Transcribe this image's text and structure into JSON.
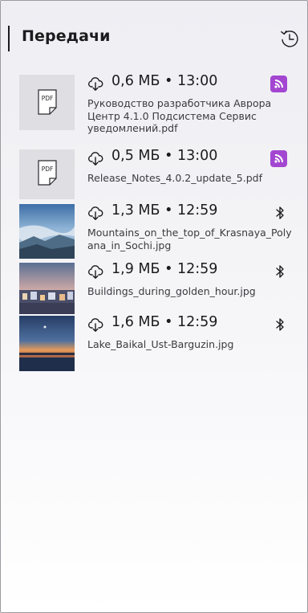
{
  "header": {
    "title": "Передачи",
    "history_icon": "history-icon"
  },
  "transfers": [
    {
      "thumb": "pdf",
      "pdf_label": "PDF",
      "size": "0,6 МБ",
      "time": "13:00",
      "channel": "aurora-badge-icon",
      "name": "Руководство разработчика Аврора Центр 4.1.0 Подсистема Сервис уведомлений.pdf"
    },
    {
      "thumb": "pdf",
      "pdf_label": "PDF",
      "size": "0,5 МБ",
      "time": "13:00",
      "channel": "aurora-badge-icon",
      "name": "Release_Notes_4.0.2_update_5.pdf"
    },
    {
      "thumb": "photo-mountains",
      "size": "1,3 МБ",
      "time": "12:59",
      "channel": "bluetooth-icon",
      "name": "Mountains_on_the_top_of_Krasnaya_Polyana_in_Sochi.jpg"
    },
    {
      "thumb": "photo-buildings",
      "size": "1,9 МБ",
      "time": "12:59",
      "channel": "bluetooth-icon",
      "name": "Buildings_during_golden_hour.jpg"
    },
    {
      "thumb": "photo-lake",
      "size": "1,6 МБ",
      "time": "12:59",
      "channel": "bluetooth-icon",
      "name": "Lake_Baikal_Ust-Barguzin.jpg"
    }
  ],
  "colors": {
    "badge": "#a347d1",
    "text": "#1c1c1f",
    "secondary": "#3a3a40"
  }
}
